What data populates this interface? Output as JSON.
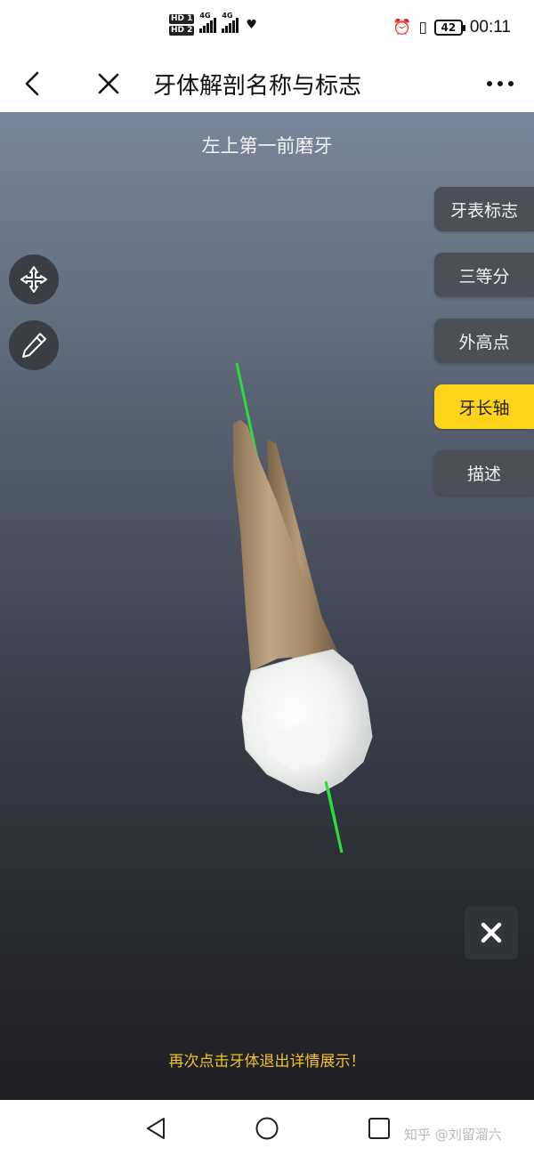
{
  "status_bar": {
    "hd1": "HD 1",
    "hd2": "HD 2",
    "net1": "4G",
    "net2": "4G",
    "battery": "42",
    "time": "00:11",
    "icons": [
      "signal-icon",
      "heart-icon",
      "alarm-icon",
      "vibrate-icon",
      "battery-icon"
    ]
  },
  "header": {
    "title": "牙体解剖名称与标志",
    "back_icon": "chevron-left-icon",
    "close_icon": "close-icon",
    "more_icon": "more-icon"
  },
  "viewer": {
    "tooth_name": "左上第一前磨牙",
    "right_buttons": [
      {
        "label": "牙表标志",
        "active": false
      },
      {
        "label": "三等分",
        "active": false
      },
      {
        "label": "外高点",
        "active": false
      },
      {
        "label": "牙长轴",
        "active": true
      },
      {
        "label": "描述",
        "active": false
      }
    ],
    "left_tools": [
      "move-icon",
      "pencil-icon"
    ],
    "exit_hint": "再次点击牙体退出详情展示！",
    "colors": {
      "active_button": "#fed31a",
      "axis_line": "#2ddc3c",
      "hint_text": "#f3c12d"
    }
  },
  "nav_bar": {
    "watermark": "知乎 @刘留溜六"
  }
}
